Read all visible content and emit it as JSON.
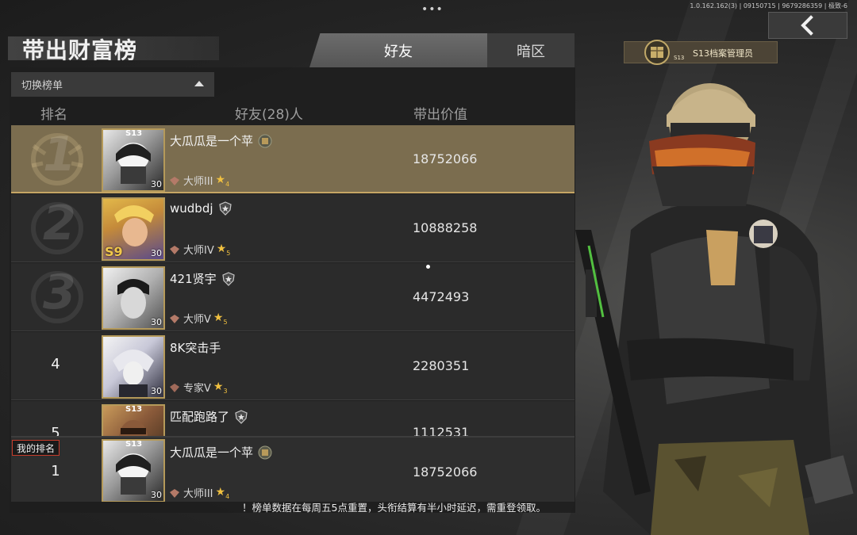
{
  "top_bar": {
    "menu_dots": "•••",
    "version_info": "1.0.162.162(3) | 09150715 | 9679286359 | 极致-6"
  },
  "page": {
    "title": "带出财富榜"
  },
  "tabs": [
    {
      "label": "好友",
      "active": true
    },
    {
      "label": "暗区",
      "active": false
    }
  ],
  "switch_list": {
    "label": "切换榜单"
  },
  "columns": {
    "rank": "排名",
    "friends": "好友(28)人",
    "value": "带出价值"
  },
  "rows": [
    {
      "rank": "1",
      "name": "大瓜瓜是一个苹",
      "tier": "大师III",
      "star_count": "4",
      "value": "18752066",
      "level": "30",
      "season_tag": "S13"
    },
    {
      "rank": "2",
      "name": "wudbdj",
      "tier": "大师IV",
      "star_count": "5",
      "value": "10888258",
      "level": "30",
      "season_tag": "S9"
    },
    {
      "rank": "3",
      "name": "421贤宇",
      "tier": "大师V",
      "star_count": "5",
      "value": "4472493",
      "level": "30"
    },
    {
      "rank": "4",
      "name": "8K突击手",
      "tier": "专家V",
      "star_count": "3",
      "value": "2280351",
      "level": "30"
    },
    {
      "rank": "5",
      "name": "匹配跑路了",
      "value": "1112531",
      "season_tag": "S13"
    }
  ],
  "my_rank": {
    "label": "我的排名",
    "rank": "1",
    "name": "大瓜瓜是一个苹",
    "tier": "大师III",
    "star_count": "4",
    "value": "18752066",
    "level": "30",
    "season_tag": "S13"
  },
  "footer": {
    "note": "！榜单数据在每周五5点重置，头衔结算有半小时延迟，需重登领取。"
  },
  "season_badge": {
    "label": "S13档案管理员",
    "tag": "S13"
  },
  "colors": {
    "gold_row": "#7b6d4f",
    "gold_border": "#c5a564",
    "panel": "#1e1e1e",
    "my_rank_border": "#c63b2a",
    "star": "#f0c040"
  }
}
